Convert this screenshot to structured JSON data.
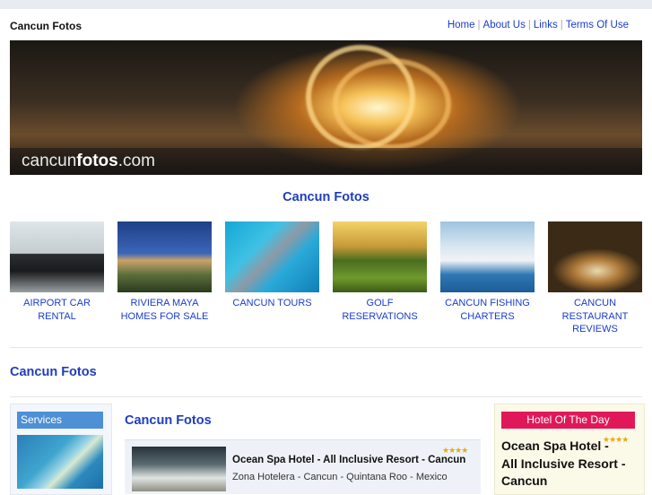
{
  "header": {
    "site_name": "Cancun Fotos",
    "nav": [
      "Home",
      "About Us",
      "Links",
      "Terms Of Use"
    ]
  },
  "banner": {
    "logo_prefix": "cancun",
    "logo_bold": "fotos",
    "logo_suffix": ".com"
  },
  "center_title": "Cancun Fotos",
  "tiles": [
    {
      "label": "AIRPORT CAR RENTAL",
      "icon": "car-image"
    },
    {
      "label": "RIVIERA MAYA HOMES FOR SALE",
      "icon": "house-image"
    },
    {
      "label": "CANCUN TOURS",
      "icon": "dolphin-image"
    },
    {
      "label": "GOLF RESERVATIONS",
      "icon": "golf-image"
    },
    {
      "label": "CANCUN FISHING CHARTERS",
      "icon": "boat-image"
    },
    {
      "label": "CANCUN RESTAURANT REVIEWS",
      "icon": "food-image"
    }
  ],
  "section_title": "Cancun Fotos",
  "left_sidebar": {
    "heading": "Services"
  },
  "main": {
    "title": "Cancun Fotos",
    "hotel": {
      "name": "Ocean Spa Hotel - All Inclusive Resort - Cancun",
      "location": "Zona Hotelera - Cancun - Quintana Roo - Mexico",
      "stars": "★★★★"
    }
  },
  "right_sidebar": {
    "heading": "Hotel Of The Day",
    "hotel_name": "Ocean Spa Hotel - All Inclusive Resort - Cancun",
    "stars": "★★★★"
  },
  "colors": {
    "link": "#1a3ccc",
    "title": "#1f3dbd",
    "services": "#4d90d6",
    "hotel_of_day": "#e0185a"
  }
}
